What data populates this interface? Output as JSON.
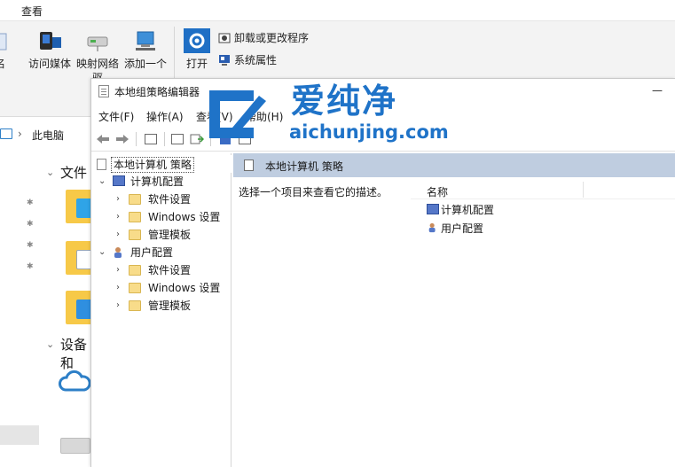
{
  "explorer": {
    "tab_view": "查看",
    "ribbon": {
      "partial_left": "命名",
      "access_media": "访问媒体",
      "map_network": "映射网络",
      "map_network_2": "驱",
      "add_one": "添加一个",
      "open": "打开",
      "uninstall": "卸载或更改程序",
      "system_props": "系统属性"
    },
    "address": {
      "location": "此电脑"
    },
    "nav": {
      "files_heading": "文件",
      "devices_heading": "设备和"
    }
  },
  "gpe": {
    "title": "本地组策略编辑器",
    "menu": {
      "file": "文件(F)",
      "action": "操作(A)",
      "view": "查看(V)",
      "help": "帮助(H)"
    },
    "tree": {
      "root": "本地计算机 策略",
      "computer_config": "计算机配置",
      "user_config": "用户配置",
      "software_settings": "软件设置",
      "windows_settings": "Windows 设置",
      "admin_templates": "管理模板"
    },
    "content": {
      "header": "本地计算机 策略",
      "description": "选择一个项目来查看它的描述。",
      "column_name": "名称",
      "items": [
        "计算机配置",
        "用户配置"
      ]
    }
  },
  "watermark": {
    "cn": "爱纯净",
    "en": "aichunjing.com",
    "color": "#1f73c8"
  }
}
